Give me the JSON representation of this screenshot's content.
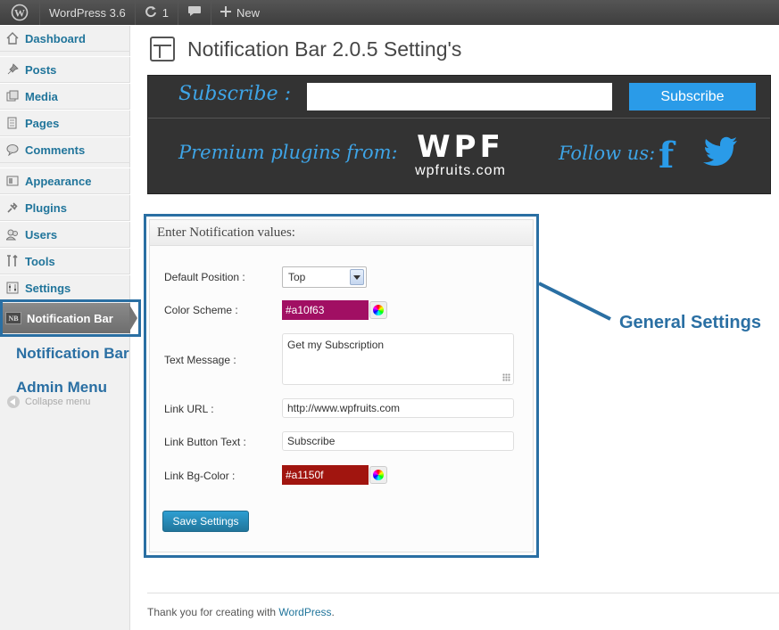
{
  "admin_bar": {
    "site_name": "WordPress 3.6",
    "updates_count": "1",
    "new_label": "New"
  },
  "sidebar": {
    "items": [
      {
        "label": "Dashboard",
        "icon": "dashboard-icon"
      },
      {
        "label": "Posts",
        "icon": "pin-icon"
      },
      {
        "label": "Media",
        "icon": "media-icon"
      },
      {
        "label": "Pages",
        "icon": "pages-icon"
      },
      {
        "label": "Comments",
        "icon": "comment-icon"
      },
      {
        "label": "Appearance",
        "icon": "appearance-icon"
      },
      {
        "label": "Plugins",
        "icon": "plugin-icon"
      },
      {
        "label": "Users",
        "icon": "users-icon"
      },
      {
        "label": "Tools",
        "icon": "tools-icon"
      },
      {
        "label": "Settings",
        "icon": "settings-icon"
      }
    ],
    "current_item": {
      "label": "Notification Bar",
      "icon_text": "NB"
    },
    "collapse_label": "Collapse menu"
  },
  "annotations": {
    "left_line1": "Notification Bar",
    "left_line2": "Admin Menu",
    "right": "General Settings",
    "color": "#2a6fa3"
  },
  "page": {
    "title": "Notification Bar 2.0.5 Setting's"
  },
  "banner": {
    "subscribe_label": "Subscribe :",
    "subscribe_input_value": "",
    "subscribe_button": "Subscribe",
    "premium_text": "Premium plugins from:",
    "logo_big": "WPF",
    "logo_small": "wpfruits.com",
    "follow_text": "Follow us:",
    "facebook_glyph": "f"
  },
  "form": {
    "heading": "Enter Notification values:",
    "default_position_label": "Default Position :",
    "default_position_value": "Top",
    "color_scheme_label": "Color Scheme :",
    "color_scheme_value": "#a10f63",
    "text_message_label": "Text Message :",
    "text_message_value": "Get my Subscription",
    "link_url_label": "Link URL :",
    "link_url_value": "http://www.wpfruits.com",
    "link_button_text_label": "Link Button Text :",
    "link_button_text_value": "Subscribe",
    "link_bg_color_label": "Link Bg-Color :",
    "link_bg_color_value": "#a1150f",
    "save_button": "Save Settings"
  },
  "footer": {
    "text": "Thank you for creating with",
    "link": "WordPress",
    "suffix": "."
  }
}
